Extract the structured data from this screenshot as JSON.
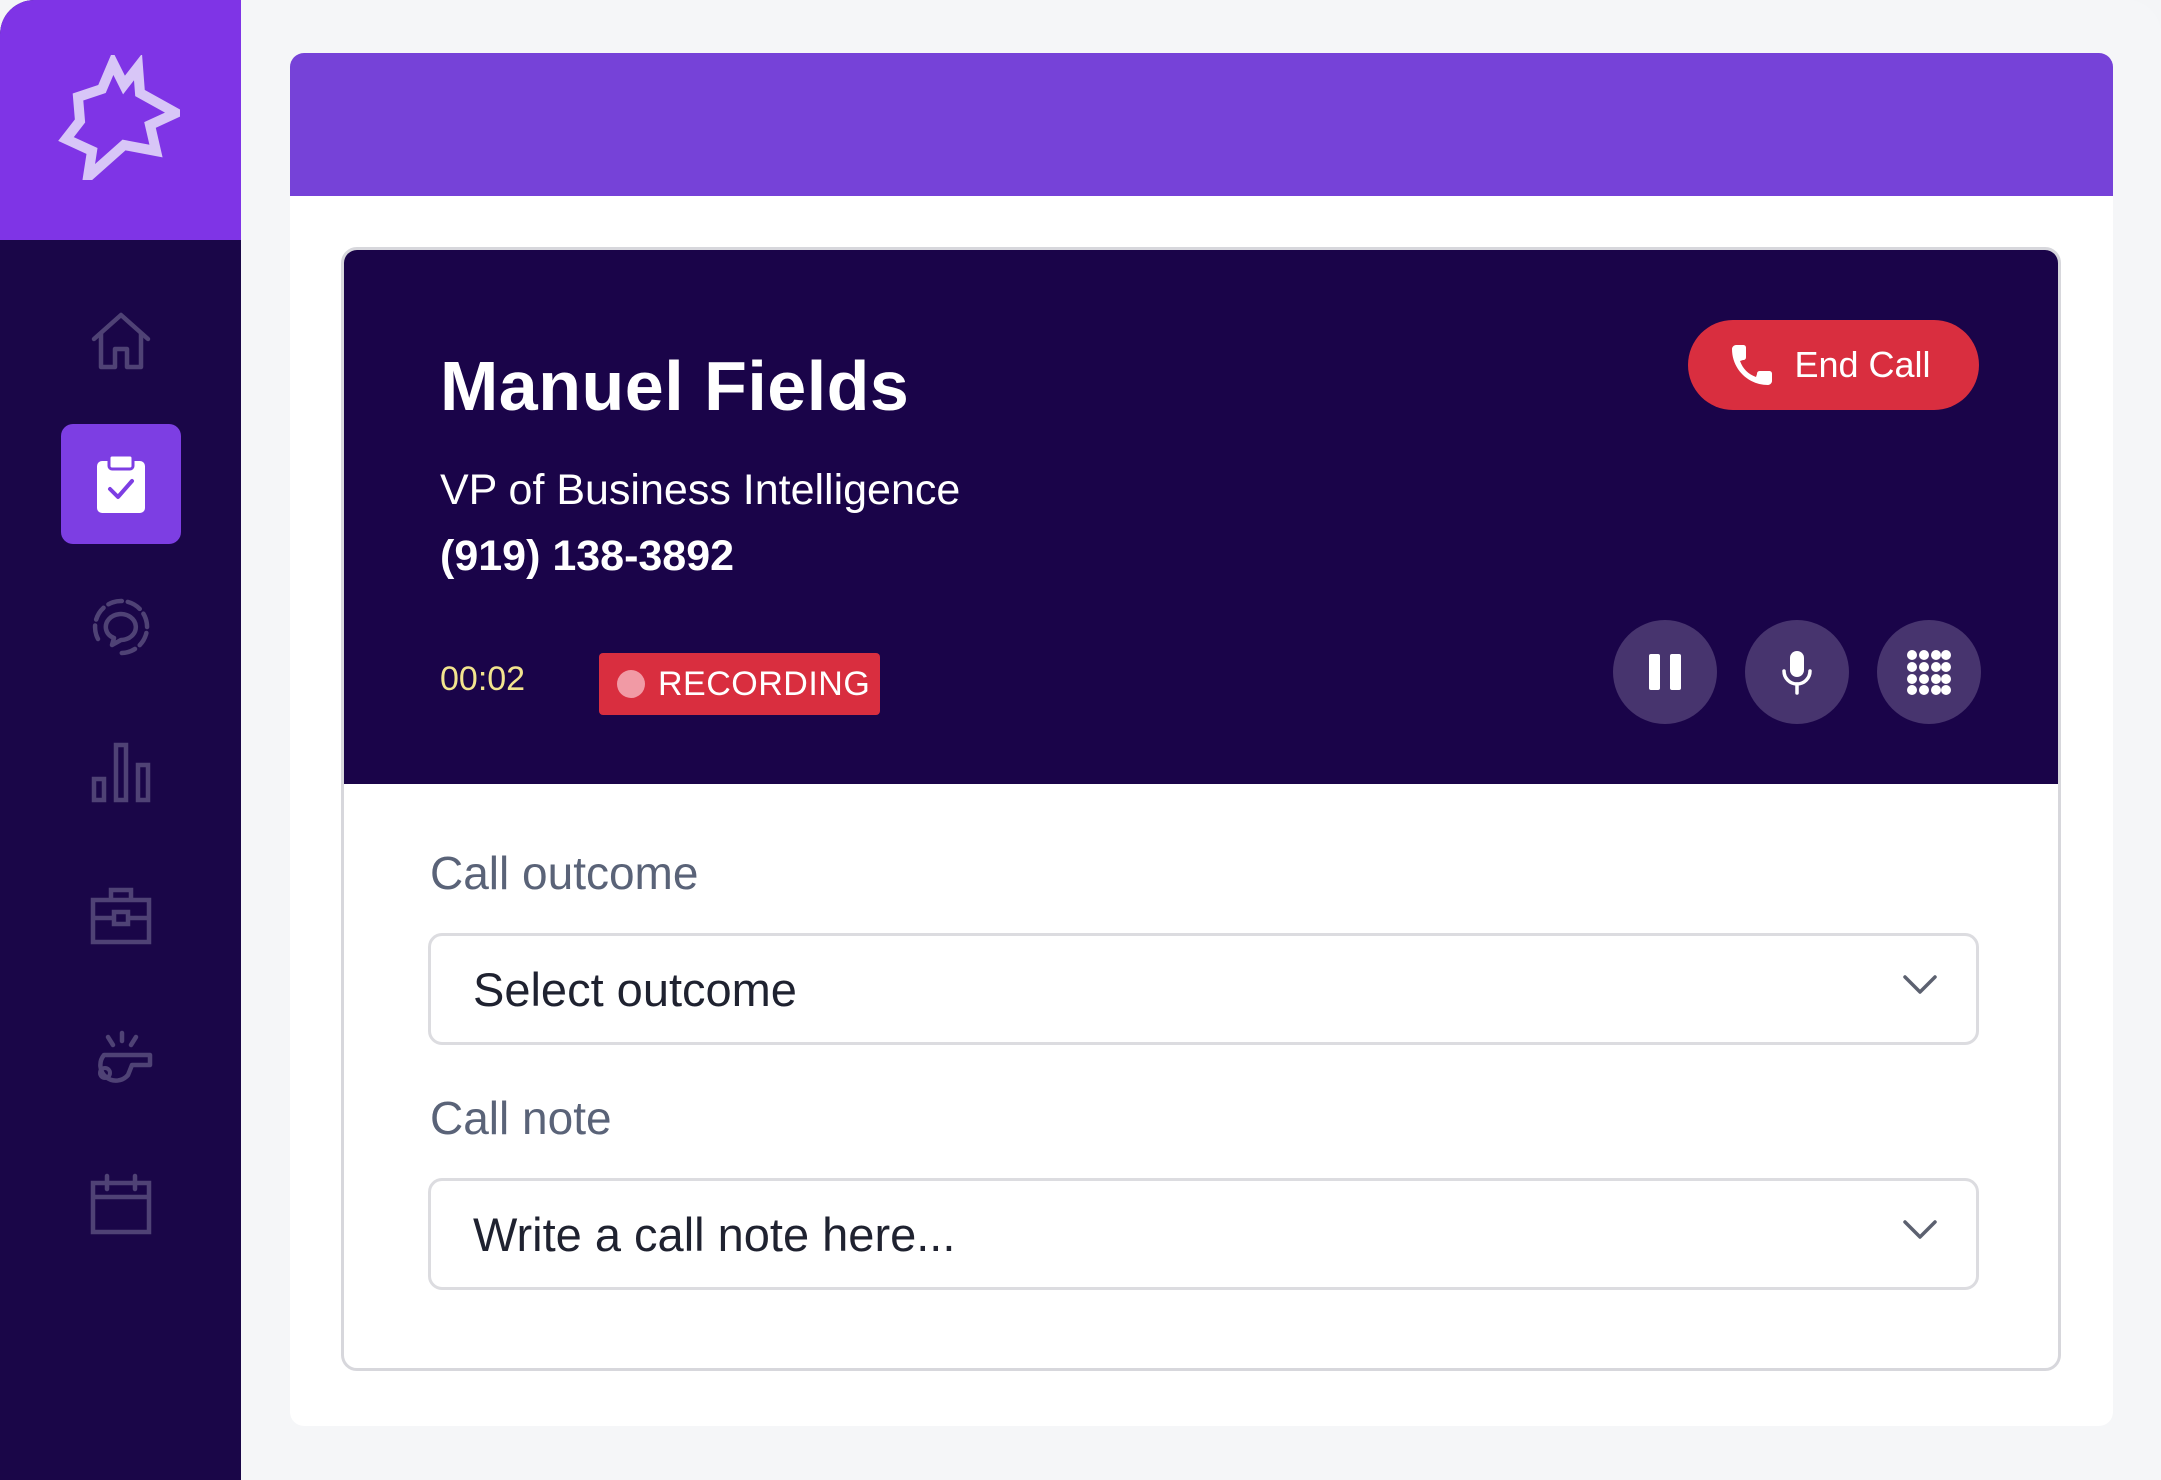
{
  "sidebar": {
    "logo": "starburst-logo",
    "items": [
      {
        "icon": "home-icon",
        "active": false
      },
      {
        "icon": "clipboard-check-icon",
        "active": true
      },
      {
        "icon": "chat-bubbles-icon",
        "active": false
      },
      {
        "icon": "bar-chart-icon",
        "active": false
      },
      {
        "icon": "briefcase-icon",
        "active": false
      },
      {
        "icon": "whistle-icon",
        "active": false
      },
      {
        "icon": "calendar-icon",
        "active": false
      }
    ]
  },
  "call": {
    "contact_name": "Manuel Fields",
    "contact_title": "VP of Business Intelligence",
    "contact_phone": "(919) 138-3892",
    "end_call_label": "End Call",
    "timer": "00:02",
    "recording_label": "RECORDING",
    "controls": [
      "pause-icon",
      "microphone-icon",
      "keypad-icon"
    ]
  },
  "form": {
    "outcome_label": "Call outcome",
    "outcome_value": "Select outcome",
    "note_label": "Call note",
    "note_placeholder": "Write a call note here..."
  },
  "colors": {
    "sidebar_bg": "#1a0648",
    "logo_bg": "#7f34e6",
    "top_bar": "#7642d8",
    "call_header_bg": "#1a0449",
    "danger": "#d92e3f",
    "timer": "#f2e48e"
  }
}
